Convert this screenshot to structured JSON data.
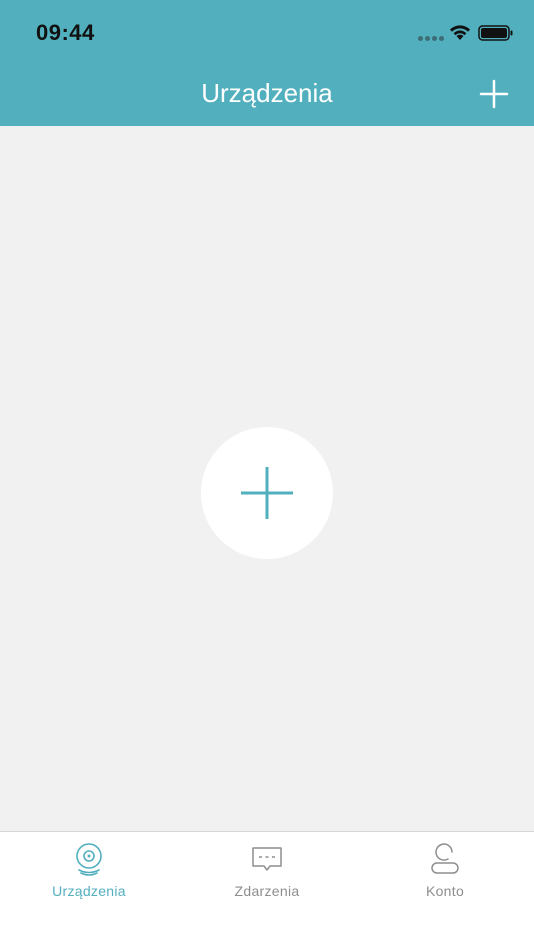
{
  "status_bar": {
    "time": "09:44"
  },
  "header": {
    "title": "Urządzenia"
  },
  "tabs": [
    {
      "label": "Urządzenia",
      "icon": "camera-icon",
      "active": true
    },
    {
      "label": "Zdarzenia",
      "icon": "message-icon",
      "active": false
    },
    {
      "label": "Konto",
      "icon": "person-icon",
      "active": false
    }
  ],
  "colors": {
    "accent": "#52afbe",
    "background": "#f1f1f1",
    "inactive_tab": "#8e8e8e"
  }
}
